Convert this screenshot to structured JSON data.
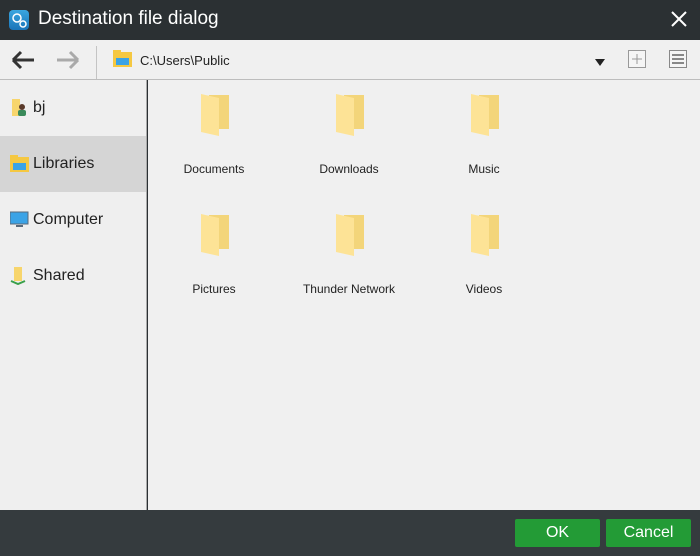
{
  "title": "Destination file dialog",
  "toolbar": {
    "path": "C:\\Users\\Public"
  },
  "sidebar": {
    "items": [
      {
        "label": "bj",
        "icon": "user-folder-icon"
      },
      {
        "label": "Libraries",
        "icon": "library-icon",
        "selected": true
      },
      {
        "label": "Computer",
        "icon": "computer-icon"
      },
      {
        "label": "Shared",
        "icon": "shared-folder-icon"
      }
    ]
  },
  "folders": [
    {
      "label": "Documents"
    },
    {
      "label": "Downloads"
    },
    {
      "label": "Music"
    },
    {
      "label": "Pictures"
    },
    {
      "label": "Thunder Network"
    },
    {
      "label": "Videos"
    }
  ],
  "footer": {
    "ok": "OK",
    "cancel": "Cancel"
  },
  "colors": {
    "accent": "#239b36",
    "titlebar": "#2b3033"
  }
}
